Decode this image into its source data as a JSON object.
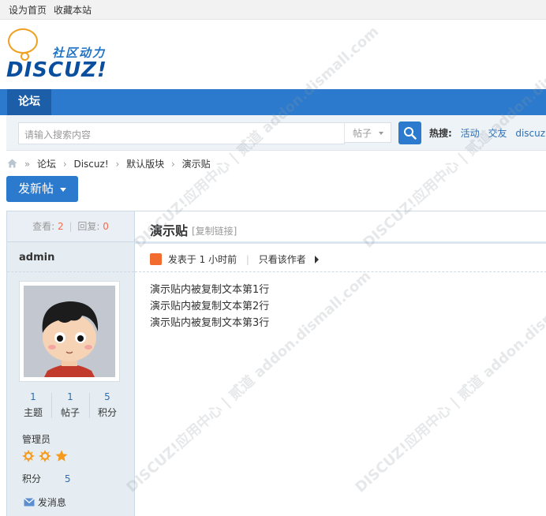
{
  "topbar": {
    "set_home": "设为首页",
    "bookmark": "收藏本站"
  },
  "logo": {
    "cn": "社区动力",
    "en": "DISCUZ!"
  },
  "nav": {
    "tab_forum": "论坛"
  },
  "search": {
    "placeholder": "请输入搜索内容",
    "type": "帖子",
    "hot_label": "热搜:",
    "hot": [
      "活动",
      "交友",
      "discuz"
    ]
  },
  "breadcrumb": [
    "论坛",
    "Discuz!",
    "默认版块",
    "演示贴"
  ],
  "post_button": "发新帖",
  "thread": {
    "views_label": "查看:",
    "views": "2",
    "sep": "|",
    "replies_label": "回复:",
    "replies": "0",
    "title": "演示贴",
    "copy_link": "[复制链接]",
    "meta": {
      "posted": "发表于 1 小时前",
      "only_author": "只看该作者"
    },
    "content": [
      "演示贴内被复制文本第1行",
      "演示贴内被复制文本第2行",
      "演示贴内被复制文本第3行"
    ]
  },
  "author": {
    "name": "admin",
    "stats": [
      {
        "value": "1",
        "label": "主题"
      },
      {
        "value": "1",
        "label": "帖子"
      },
      {
        "value": "5",
        "label": "积分"
      }
    ],
    "group": "管理员",
    "points_label": "积分",
    "points": "5",
    "message": "发消息"
  },
  "watermark": "DISCUZ!应用中心 | 贰道  addon.dismall.com",
  "colors": {
    "accent": "#2b7acd",
    "nav_active": "#1c5fa8",
    "link": "#2b6fb2",
    "highlight": "#f26c4f"
  }
}
